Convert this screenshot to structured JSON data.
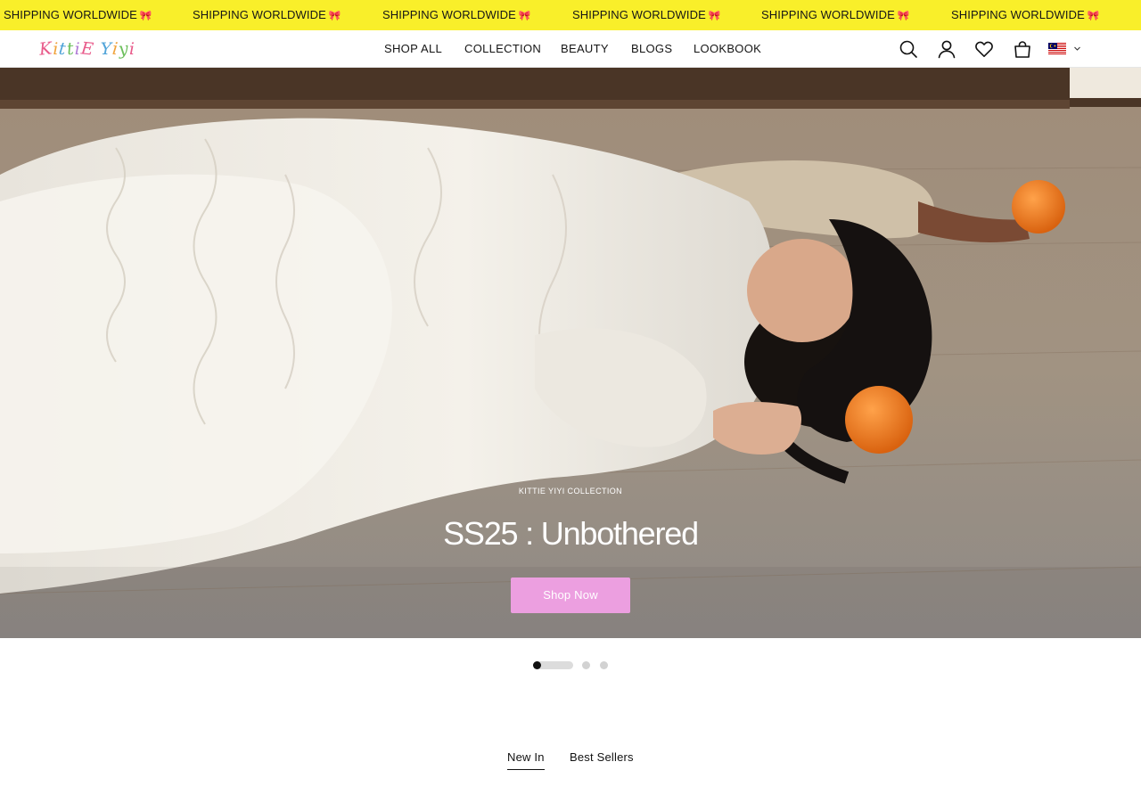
{
  "announcement": {
    "items": [
      "SHIPPING WORLDWIDE",
      "SHIPPING WORLDWIDE",
      "SHIPPING WORLDWIDE",
      "SHIPPING WORLDWIDE",
      "SHIPPING WORLDWIDE",
      "SHIPPING WORLDWIDE"
    ],
    "background_color": "#f9ef2a",
    "emoji_icon": "ribbon-bow-icon"
  },
  "header": {
    "logo_letters": [
      "K",
      "i",
      "t",
      "t",
      "i",
      "E",
      " ",
      "Y",
      "i",
      "y",
      "i"
    ],
    "logo_colors": [
      "#e85a8a",
      "#f0a23a",
      "#4fa3d8",
      "#6cbf5c",
      "#b07ad6",
      "#e85a8a",
      " ",
      "#4fa3d8",
      "#f0a23a",
      "#6cbf5c",
      "#e85a8a"
    ],
    "nav": [
      "SHOP ALL",
      "COLLECTION",
      "BEAUTY",
      "BLOGS",
      "LOOKBOOK"
    ],
    "icons": [
      "search-icon",
      "account-icon",
      "wishlist-heart-icon",
      "cart-bag-icon"
    ],
    "country_flag": "malaysia-flag-icon",
    "country_chevron": "chevron-down-icon"
  },
  "hero": {
    "eyebrow": "KITTIE YIYI COLLECTION",
    "title": "SS25 : Unbothered",
    "cta_label": "Shop Now",
    "cta_color": "#ec9fe0",
    "slides_total": 3,
    "active_slide": 1
  },
  "tabs": {
    "items": [
      "New In",
      "Best Sellers"
    ],
    "active": "New In"
  }
}
